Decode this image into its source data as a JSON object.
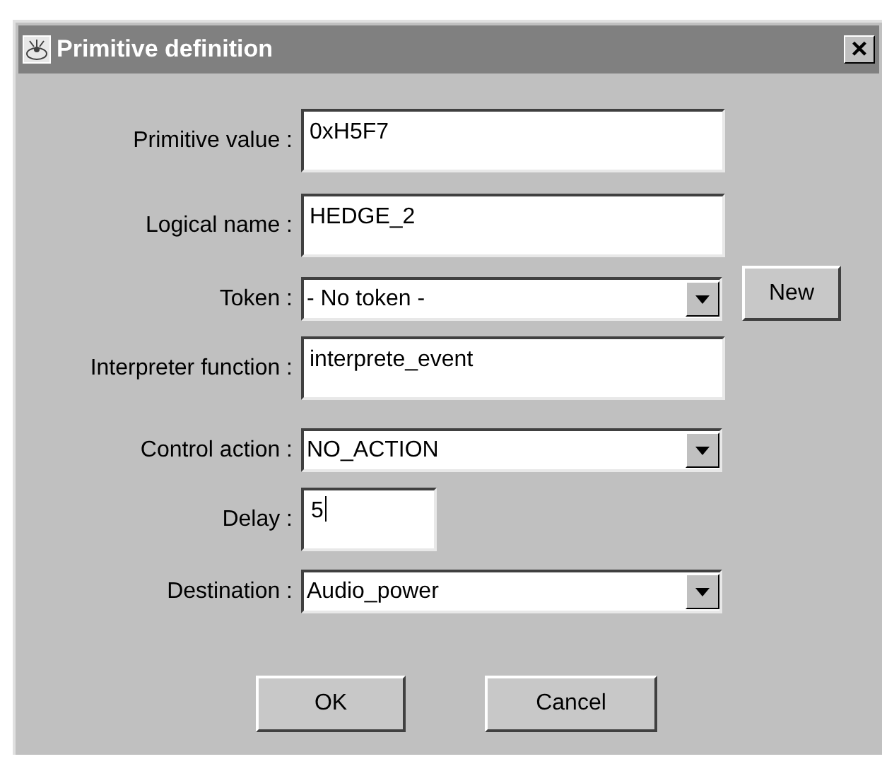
{
  "window": {
    "title": "Primitive definition",
    "close": "×"
  },
  "fields": [
    {
      "kind": "text",
      "label": "Primitive value :",
      "value": "0xH5F7"
    },
    {
      "kind": "text",
      "label": "Logical name :",
      "value": "HEDGE_2"
    },
    {
      "kind": "combo",
      "label": "Token :",
      "value": "- No token -",
      "button": "New"
    },
    {
      "kind": "text",
      "label": "Interpreter function :",
      "value": "interprete_event"
    },
    {
      "kind": "combo",
      "label": "Control action :",
      "value": "NO_ACTION"
    },
    {
      "kind": "short",
      "label": "Delay :",
      "value": "5",
      "focused": true
    },
    {
      "kind": "combo",
      "label": "Destination :",
      "value": "Audio_power"
    }
  ],
  "buttons": [
    "OK",
    "Cancel"
  ]
}
